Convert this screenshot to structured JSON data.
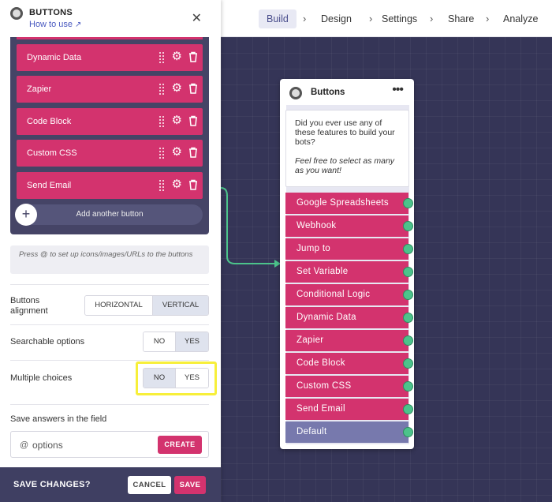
{
  "panel": {
    "title": "BUTTONS",
    "how_to_use": "How to use",
    "buttons": [
      "Dynamic Data",
      "Zapier",
      "Code Block",
      "Custom CSS",
      "Send Email"
    ],
    "add_button": "Add another button",
    "hint": "Press @ to set up icons/images/URLs to the buttons",
    "alignment": {
      "label": "Buttons alignment",
      "options": [
        "HORIZONTAL",
        "VERTICAL"
      ],
      "selected": "VERTICAL"
    },
    "searchable": {
      "label": "Searchable options",
      "options": [
        "NO",
        "YES"
      ],
      "selected": "YES"
    },
    "multiple": {
      "label": "Multiple choices",
      "options": [
        "NO",
        "YES"
      ],
      "selected": "NO"
    },
    "save_field": {
      "label": "Save answers in the field",
      "prefix": "@",
      "value": "options",
      "create": "CREATE"
    }
  },
  "footer": {
    "label": "SAVE CHANGES?",
    "cancel": "CANCEL",
    "save": "SAVE"
  },
  "nav": {
    "steps": [
      "Build",
      "Design",
      "Settings",
      "Share",
      "Analyze"
    ],
    "active": "Build"
  },
  "node": {
    "title": "Buttons",
    "message": "Did you ever use any of these features to build your bots?",
    "message_em": "Feel free to select as many as you want!",
    "choices": [
      "Google Spreadsheets",
      "Webhook",
      "Jump to",
      "Set Variable",
      "Conditional Logic",
      "Dynamic Data",
      "Zapier",
      "Code Block",
      "Custom CSS",
      "Send Email"
    ],
    "default": "Default"
  },
  "colors": {
    "accent": "#d3336e",
    "panel_dark": "#454466",
    "connector": "#4cc38b",
    "default_choice": "#7779ad",
    "highlight": "#f7ef3a"
  }
}
